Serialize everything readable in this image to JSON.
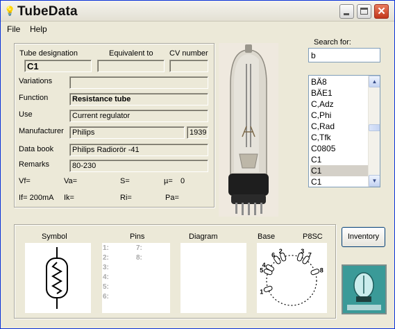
{
  "window": {
    "title": "TubeData"
  },
  "menu": {
    "file": "File",
    "help": "Help"
  },
  "headers": {
    "designation": "Tube designation",
    "equivalent": "Equivalent to",
    "cv": "CV number"
  },
  "tube": {
    "designation": "C1",
    "equivalent": "",
    "cv_number": "",
    "variations": "",
    "function": "Resistance tube",
    "use": "Current regulator",
    "manufacturer": "Philips",
    "year": "1939",
    "data_book": "Philips Radiorör -41",
    "remarks": "80-230"
  },
  "labels": {
    "variations": "Variations",
    "function": "Function",
    "use": "Use",
    "manufacturer": "Manufacturer",
    "data_book": "Data book",
    "remarks": "Remarks"
  },
  "params": {
    "vf": "Vf=",
    "va": "Va=",
    "s": "S=",
    "mu": "µ=",
    "mu_value": "0",
    "if": "If= 200mA",
    "ik": "Ik=",
    "ri": "Ri=",
    "pa": "Pa="
  },
  "search": {
    "label": "Search for:",
    "value": "b"
  },
  "list": [
    "BÄ8",
    "BÄE1",
    "C,Adz",
    "C,Phi",
    "C,Rad",
    "C,Tfk",
    "C0805",
    "C1",
    "C1",
    "C1"
  ],
  "bottom": {
    "symbol": "Symbol",
    "pins": "Pins",
    "diagram": "Diagram",
    "base": "Base",
    "base_type": "P8SC",
    "pins_col1": [
      "1:",
      "2:",
      "3:",
      "4:",
      "5:",
      "6:"
    ],
    "pins_col2": [
      "7:",
      "8:"
    ],
    "base_pin_numbers": [
      "1",
      "2",
      "3",
      "4",
      "5",
      "6",
      "7",
      "8"
    ]
  },
  "buttons": {
    "inventory": "Inventory"
  },
  "colors": {
    "title_bar": "#e3e0d3",
    "window_bg": "#ece9d8",
    "close_button": "#c2361a",
    "selection": "#d4d0c8"
  }
}
